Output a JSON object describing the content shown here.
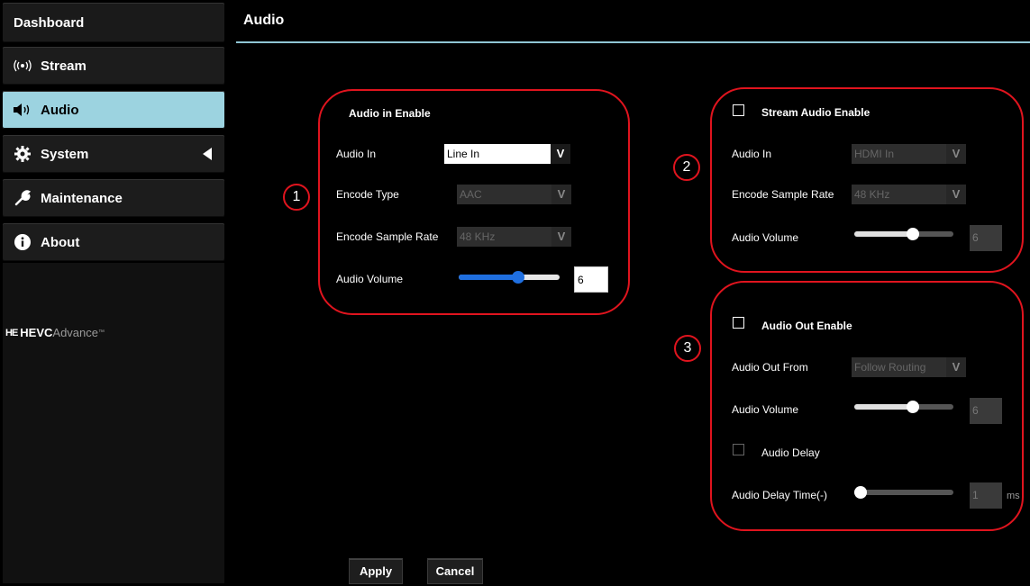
{
  "sidebar": {
    "header": "Dashboard",
    "items": [
      {
        "label": "Stream",
        "icon": "broadcast-icon"
      },
      {
        "label": "Audio",
        "icon": "speaker-icon",
        "active": true
      },
      {
        "label": "System",
        "icon": "gear-icon",
        "expandable": true
      },
      {
        "label": "Maintenance",
        "icon": "wrench-icon"
      },
      {
        "label": "About",
        "icon": "info-icon"
      }
    ],
    "logo": {
      "mark": "HE",
      "brand": "HEVC",
      "suffix": "Advance",
      "tm": "™"
    }
  },
  "header": {
    "title": "Audio"
  },
  "panel1": {
    "number": "1",
    "title": "Audio in Enable",
    "audio_in_label": "Audio In",
    "audio_in_value": "Line In",
    "encode_type_label": "Encode Type",
    "encode_type_value": "AAC",
    "sample_rate_label": "Encode Sample Rate",
    "sample_rate_value": "48 KHz",
    "volume_label": "Audio Volume",
    "volume_value": "6",
    "volume_fraction": 0.6
  },
  "panel2": {
    "number": "2",
    "enable_label": "Stream Audio Enable",
    "audio_in_label": "Audio In",
    "audio_in_value": "HDMI In",
    "sample_rate_label": "Encode Sample Rate",
    "sample_rate_value": "48 KHz",
    "volume_label": "Audio Volume",
    "volume_value": "6",
    "volume_fraction": 0.6
  },
  "panel3": {
    "number": "3",
    "enable_label": "Audio Out Enable",
    "out_from_label": "Audio Out From",
    "out_from_value": "Follow Routing",
    "volume_label": "Audio Volume",
    "volume_value": "6",
    "volume_fraction": 0.6,
    "delay_label": "Audio Delay",
    "delay_time_label": "Audio Delay Time(-)",
    "delay_time_value": "1",
    "delay_unit": "ms",
    "delay_fraction": 0.0
  },
  "buttons": {
    "apply": "Apply",
    "cancel": "Cancel"
  },
  "colors": {
    "accent": "#9cd3e0",
    "annotation": "#e0141e",
    "slider_blue": "#1f6fe0"
  }
}
